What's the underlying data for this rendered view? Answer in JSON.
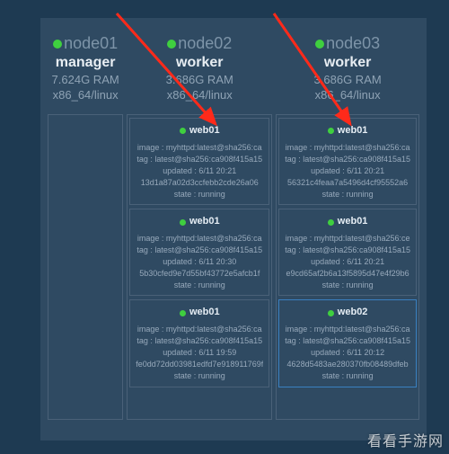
{
  "watermark": "看看手游网",
  "nodes": [
    {
      "name": "node01",
      "role": "manager",
      "ram": "7.624G RAM",
      "arch": "x86_64/linux",
      "cards": []
    },
    {
      "name": "node02",
      "role": "worker",
      "ram": "3.686G RAM",
      "arch": "x86_64/linux",
      "cards": [
        {
          "title": "web01",
          "lines": [
            "image : myhttpd:latest@sha256:ca",
            "tag : latest@sha256:ca908f415a15",
            "updated : 6/11 20:21",
            "13d1a87a02d3ccfebb2cde26a06",
            "state : running"
          ]
        },
        {
          "title": "web01",
          "lines": [
            "image : myhttpd:latest@sha256:ca",
            "tag : latest@sha256:ca908f415a15",
            "updated : 6/11 20:30",
            "5b30cfed9e7d55bf43772e5afcb1f",
            "state : running"
          ]
        },
        {
          "title": "web01",
          "lines": [
            "image : myhttpd:latest@sha256:ca",
            "tag : latest@sha256:ca908f415a15",
            "updated : 6/11 19:59",
            "fe0dd72dd03981edfd7e918911769f",
            "state : running"
          ]
        }
      ]
    },
    {
      "name": "node03",
      "role": "worker",
      "ram": "3.686G RAM",
      "arch": "x86_64/linux",
      "cards": [
        {
          "title": "web01",
          "lines": [
            "image : myhttpd:latest@sha256:ca",
            "tag : latest@sha256:ca908f415a15",
            "updated : 6/11 20:21",
            "56321c4feaa7a5496d4cf95552a6",
            "state : running"
          ]
        },
        {
          "title": "web01",
          "lines": [
            "image : myhttpd:latest@sha256:ce",
            "tag : latest@sha256:ca908f415a15",
            "updated : 6/11 20:21",
            "e9cd65af2b6a13f5895d47e4f29b6",
            "state : running"
          ]
        },
        {
          "title": "web02",
          "alt": true,
          "lines": [
            "image : myhttpd:latest@sha256:ca",
            "tag : latest@sha256:ca908f415a15",
            "updated : 6/11 20:12",
            "4628d5483ae280370fb08489dfeb",
            "state : running"
          ]
        }
      ]
    }
  ]
}
